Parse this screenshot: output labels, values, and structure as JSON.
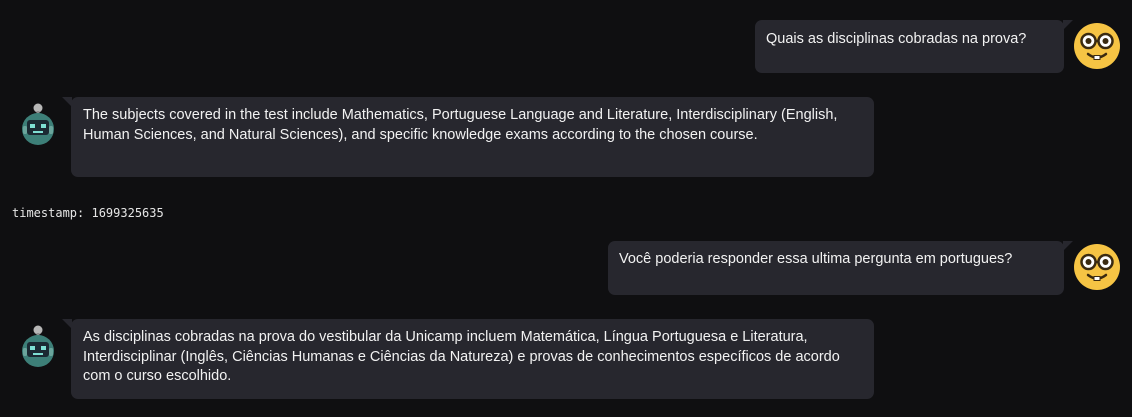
{
  "messages": [
    {
      "role": "user",
      "text": "Quais as disciplinas cobradas na prova?"
    },
    {
      "role": "assistant",
      "text": "The subjects covered in the test include Mathematics, Portuguese Language and Literature, Interdisciplinary (English, Human Sciences, and Natural Sciences), and specific knowledge exams according to the chosen course."
    },
    {
      "role": "user",
      "text": "Você poderia responder essa ultima pergunta em portugues?"
    },
    {
      "role": "assistant",
      "text": "As disciplinas cobradas na prova do vestibular da Unicamp incluem Matemática, Língua Portuguesa e Literatura, Interdisciplinar (Inglês, Ciências Humanas e Ciências da Natureza) e provas de conhecimentos específicos de acordo com o curso escolhido."
    }
  ],
  "timestamp_label": "timestamp: 1699325635",
  "icons": {
    "user_avatar": "nerd-face-icon",
    "bot_avatar": "robot-icon"
  },
  "colors": {
    "background": "#0f0f11",
    "bubble": "#27272e",
    "user_face": "#f6c444",
    "bot_face": "#3d7f78"
  }
}
